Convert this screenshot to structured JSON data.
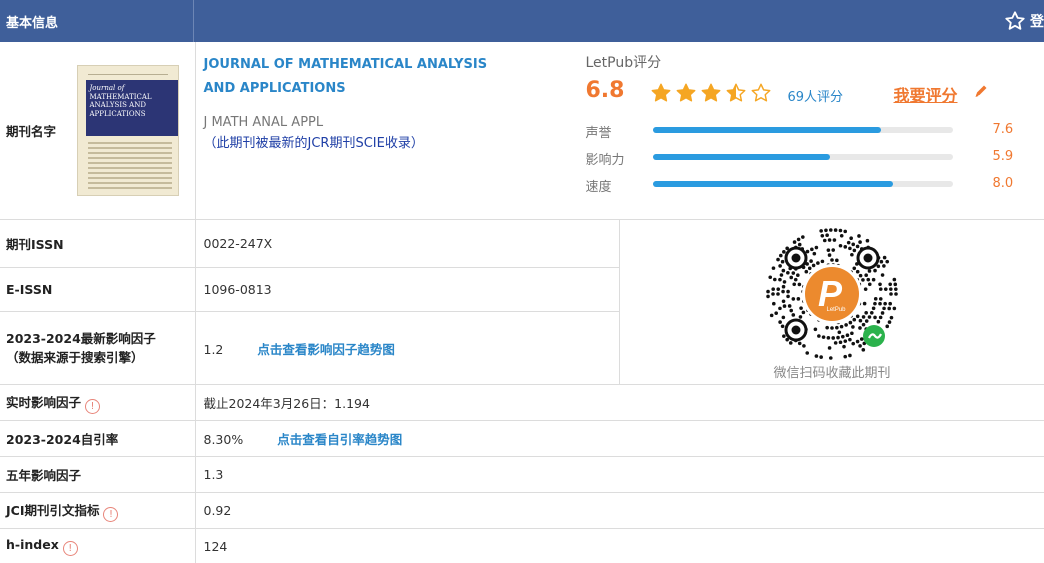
{
  "header": {
    "title": "基本信息",
    "right_label": "登"
  },
  "journal": {
    "label": "期刊名字",
    "name": "JOURNAL OF MATHEMATICAL ANALYSIS AND APPLICATIONS",
    "abbr": "J MATH ANAL APPL",
    "note": "（此期刊被最新的JCR期刊SCIE收录）",
    "cover_text": [
      "Journal of",
      "MATHEMATICAL",
      "ANALYSIS AND",
      "APPLICATIONS"
    ]
  },
  "rating": {
    "title": "LetPub评分",
    "score": "6.8",
    "stars": 3.5,
    "count": "69人评分",
    "rate_button": "我要评分",
    "bars": [
      {
        "label": "声誉",
        "value": "7.6",
        "level": 0.76
      },
      {
        "label": "影响力",
        "value": "5.9",
        "level": 0.59
      },
      {
        "label": "速度",
        "value": "8.0",
        "level": 0.8
      }
    ]
  },
  "rows": {
    "issn": {
      "label": "期刊ISSN",
      "value": "0022-247X"
    },
    "eissn": {
      "label": "E-ISSN",
      "value": "1096-0813"
    },
    "if": {
      "label1": "2023-2024最新影响因子",
      "label2": "（数据来源于搜索引擎）",
      "value": "1.2",
      "link": "点击查看影响因子趋势图"
    },
    "realtime_if": {
      "label": "实时影响因子",
      "value": "截止2024年3月26日：1.194"
    },
    "self_cite": {
      "label": "2023-2024自引率",
      "value": "8.30%",
      "link": "点击查看自引率趋势图"
    },
    "five_year_if": {
      "label": "五年影响因子",
      "value": "1.3"
    },
    "jci": {
      "label": "JCI期刊引文指标",
      "value": "0.92"
    },
    "hindex": {
      "label": "h-index",
      "value": "124"
    }
  },
  "qr": {
    "caption": "微信扫码收藏此期刊",
    "logo_text": "LetPub"
  },
  "colors": {
    "header": "#3f5f9a",
    "link": "#2a86c8",
    "accent": "#f07830",
    "bar": "#2a9be0"
  }
}
